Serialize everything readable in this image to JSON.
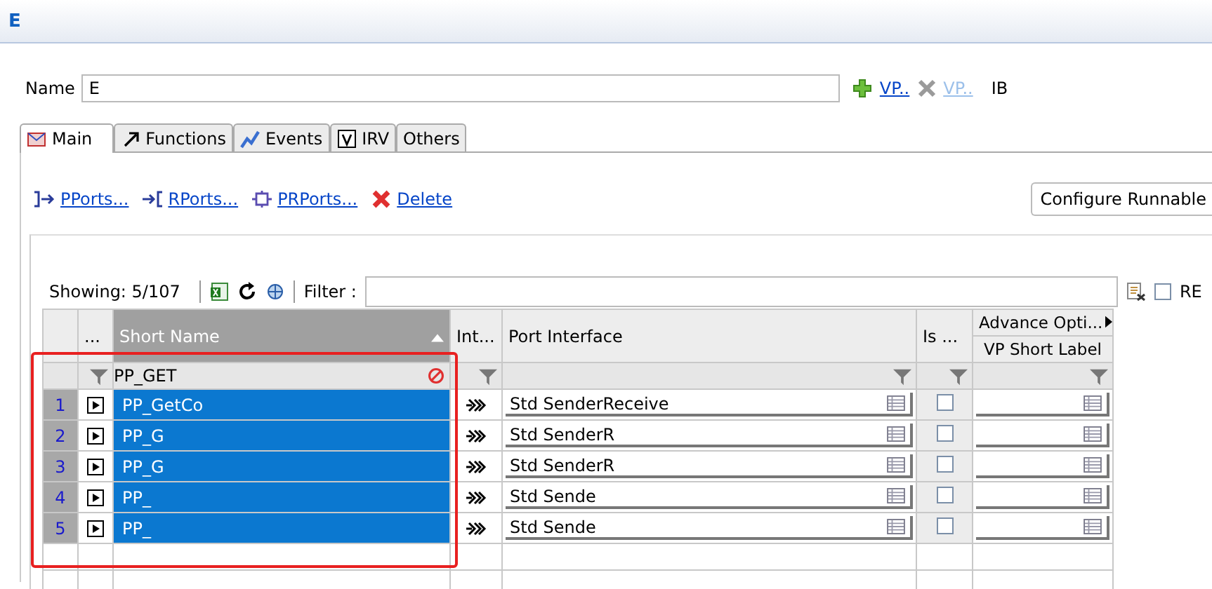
{
  "window": {
    "title": "E"
  },
  "name_field": {
    "label": "Name",
    "value": "E"
  },
  "vp_links": [
    {
      "label": "VP..",
      "disabled": false,
      "kind": "add"
    },
    {
      "label": "VP..",
      "disabled": true,
      "kind": "remove"
    }
  ],
  "ib_label": "IB",
  "tabs": [
    {
      "label": "Main",
      "selected": true,
      "kind": "main"
    },
    {
      "label": "Functions",
      "selected": false,
      "kind": "functions"
    },
    {
      "label": "Events",
      "selected": false,
      "kind": "events"
    },
    {
      "label": "IRV",
      "selected": false,
      "kind": "irv"
    },
    {
      "label": "Others",
      "selected": false,
      "kind": "none"
    }
  ],
  "actions": [
    {
      "label": "PPorts...",
      "kind": "pport"
    },
    {
      "label": "RPorts...",
      "kind": "rport"
    },
    {
      "label": "PRPorts...",
      "kind": "prport"
    },
    {
      "label": "Delete",
      "kind": "delete"
    }
  ],
  "configure_button": "Configure Runnable",
  "showing": "Showing: 5/107",
  "filter": {
    "label": "Filter :"
  },
  "re_option": {
    "label": "RE",
    "checked": false
  },
  "table": {
    "columns": [
      {
        "label": "...",
        "sorted": false
      },
      {
        "label": "Short Name",
        "sorted": true
      },
      {
        "label": "Int...",
        "sorted": false
      },
      {
        "label": "Port Interface",
        "sorted": false
      },
      {
        "label": "Is ...",
        "sorted": false
      }
    ],
    "group_header": "Advance Opti...",
    "group_column": "VP Short Label",
    "filter_value": "PP_GET",
    "rows": [
      {
        "index": "1",
        "short_name": "PP_GetCo",
        "port_interface": "Std SenderReceive",
        "is_flag": false,
        "selected": true
      },
      {
        "index": "2",
        "short_name": "PP_G",
        "port_interface": "Std SenderR",
        "is_flag": false,
        "selected": true
      },
      {
        "index": "3",
        "short_name": "PP_G",
        "port_interface": "Std SenderR",
        "is_flag": false,
        "selected": true
      },
      {
        "index": "4",
        "short_name": "PP_",
        "port_interface": "Std Sende",
        "is_flag": false,
        "selected": true
      },
      {
        "index": "5",
        "short_name": "PP_",
        "port_interface": "Std Sende",
        "is_flag": false,
        "selected": true
      }
    ]
  }
}
